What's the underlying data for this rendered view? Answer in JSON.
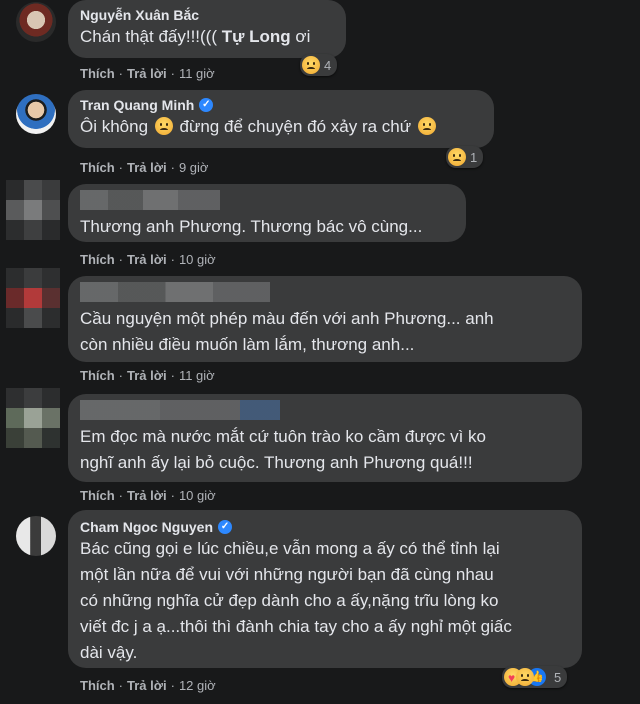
{
  "comments": [
    {
      "author": "Nguyễn Xuân Bắc",
      "text_before": "Chán thật đấy!!!((( ",
      "mention": "Tự Long",
      "text_after": " ơi",
      "like": "Thích",
      "reply": "Trả lời",
      "time": "11 giờ",
      "reaction_count": "4"
    },
    {
      "author": "Tran Quang Minh",
      "text_before": "Ôi không",
      "text_middle": "đừng để chuyện đó xảy ra chứ",
      "like": "Thích",
      "reply": "Trả lời",
      "time": "9 giờ",
      "reaction_count": "1"
    },
    {
      "text": "Thương anh Phương. Thương bác vô cùng...",
      "like": "Thích",
      "reply": "Trả lời",
      "time": "10 giờ"
    },
    {
      "line1": "Cầu nguyện một phép màu đến với anh Phương... anh",
      "line2": "còn nhiều điều muốn làm lắm, thương anh...",
      "like": "Thích",
      "reply": "Trả lời",
      "time": "11 giờ"
    },
    {
      "line1": "Em đọc mà nước mắt cứ tuôn trào ko cầm được vì ko",
      "line2": "nghĩ anh ấy lại bỏ cuộc. Thương anh Phương quá!!!",
      "like": "Thích",
      "reply": "Trả lời",
      "time": "10 giờ"
    },
    {
      "author": "Cham Ngoc Nguyen",
      "line1": "Bác cũng gọi e lúc chiều,e vẫn mong a ấy có thể tỉnh lại",
      "line2": "một lần nữa để vui với những người bạn đã cùng nhau",
      "line3": "có những nghĩa cử đẹp dành cho a ấy,nặng trĩu lòng ko",
      "line4": "viết đc j a ạ...thôi thì đành chia tay cho a ấy nghỉ một giấc",
      "line5": "dài vậy.",
      "like": "Thích",
      "reply": "Trả lời",
      "time": "12 giờ",
      "reaction_count": "5"
    }
  ],
  "colors": {
    "background": "#18191a",
    "bubble": "#3a3b3c",
    "text": "#e4e6eb",
    "secondary": "#b0b3b8",
    "verified": "#2d88ff"
  }
}
